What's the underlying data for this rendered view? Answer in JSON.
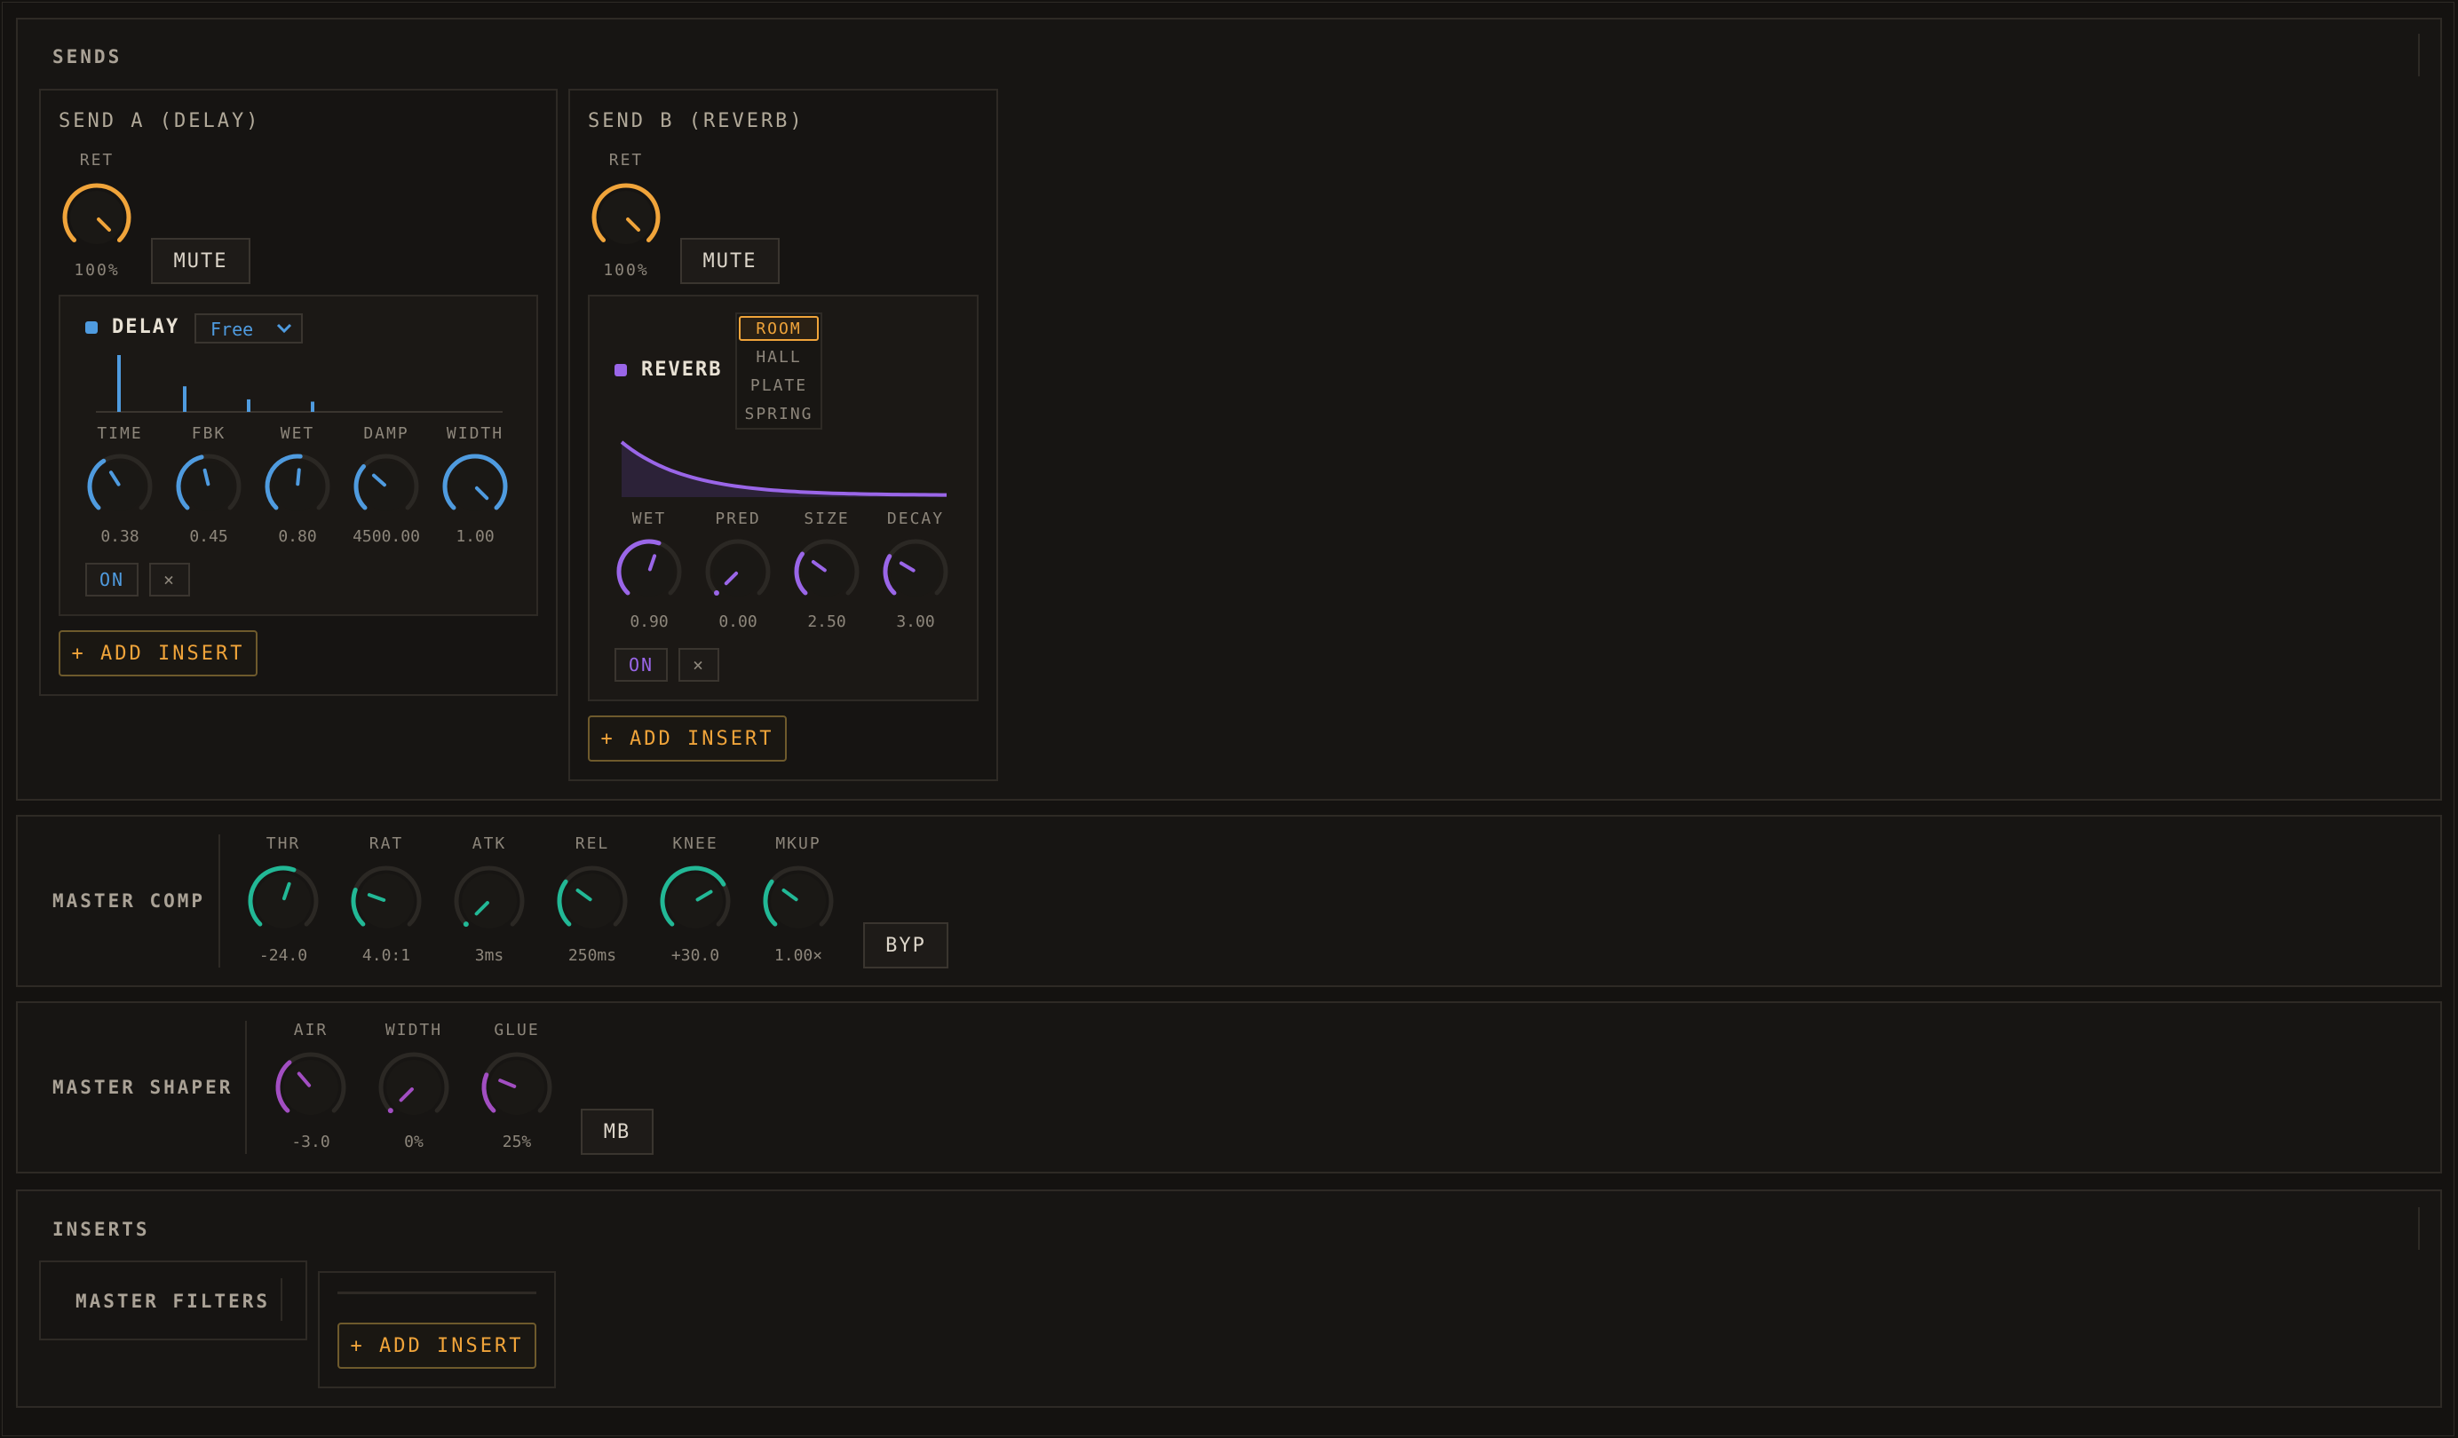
{
  "colors": {
    "bg": "#141210",
    "orange": "#f0a43a",
    "blue": "#4f9bdf",
    "purple": "#9a66e8",
    "teal": "#22b896",
    "magenta": "#a24ec2",
    "track": "#2b2824"
  },
  "sends": {
    "title": "SENDS",
    "send_a": {
      "title": "SEND A (DELAY)",
      "ret_label": "RET",
      "ret_value": "100%",
      "ret_level": 1.0,
      "mute_label": "MUTE",
      "delay": {
        "name": "DELAY",
        "mode_select": "Free",
        "mode_chevron_icon": "chevron-down-icon",
        "tap_levels": [
          1.0,
          0.45,
          0.22,
          0.18
        ],
        "knobs": [
          {
            "label": "TIME",
            "value": "0.38",
            "level": 0.38
          },
          {
            "label": "FBK",
            "value": "0.45",
            "level": 0.45
          },
          {
            "label": "WET",
            "value": "0.80",
            "level": 0.52
          },
          {
            "label": "DAMP",
            "value": "4500.00",
            "level": 0.32
          },
          {
            "label": "WIDTH",
            "value": "1.00",
            "level": 1.0
          }
        ],
        "on_label": "ON",
        "remove_label": "×"
      },
      "add_insert_label": "+ ADD INSERT"
    },
    "send_b": {
      "title": "SEND B (REVERB)",
      "ret_label": "RET",
      "ret_value": "100%",
      "ret_level": 1.0,
      "mute_label": "MUTE",
      "reverb": {
        "name": "REVERB",
        "types": [
          "ROOM",
          "HALL",
          "PLATE",
          "SPRING"
        ],
        "selected_type": "ROOM",
        "knobs": [
          {
            "label": "WET",
            "value": "0.90",
            "level": 0.57
          },
          {
            "label": "PRED",
            "value": "0.00",
            "level": 0.0
          },
          {
            "label": "SIZE",
            "value": "2.50",
            "level": 0.3
          },
          {
            "label": "DECAY",
            "value": "3.00",
            "level": 0.28
          }
        ],
        "on_label": "ON",
        "remove_label": "×"
      },
      "add_insert_label": "+ ADD INSERT"
    }
  },
  "master_comp": {
    "title": "MASTER COMP",
    "knobs": [
      {
        "label": "THR",
        "value": "-24.0",
        "level": 0.57
      },
      {
        "label": "RAT",
        "value": "4.0:1",
        "level": 0.24
      },
      {
        "label": "ATK",
        "value": "3ms",
        "level": 0.0
      },
      {
        "label": "REL",
        "value": "250ms",
        "level": 0.3
      },
      {
        "label": "KNEE",
        "value": "+30.0",
        "level": 0.72
      },
      {
        "label": "MKUP",
        "value": "1.00×",
        "level": 0.3
      }
    ],
    "bypass_label": "BYP"
  },
  "master_shaper": {
    "title": "MASTER SHAPER",
    "knobs": [
      {
        "label": "AIR",
        "value": "-3.0",
        "level": 0.35
      },
      {
        "label": "WIDTH",
        "value": "0%",
        "level": 0.0
      },
      {
        "label": "GLUE",
        "value": "25%",
        "level": 0.25
      }
    ],
    "mb_label": "MB"
  },
  "inserts": {
    "title": "INSERTS",
    "master_filters_label": "MASTER FILTERS",
    "add_insert_label": "+ ADD INSERT"
  }
}
